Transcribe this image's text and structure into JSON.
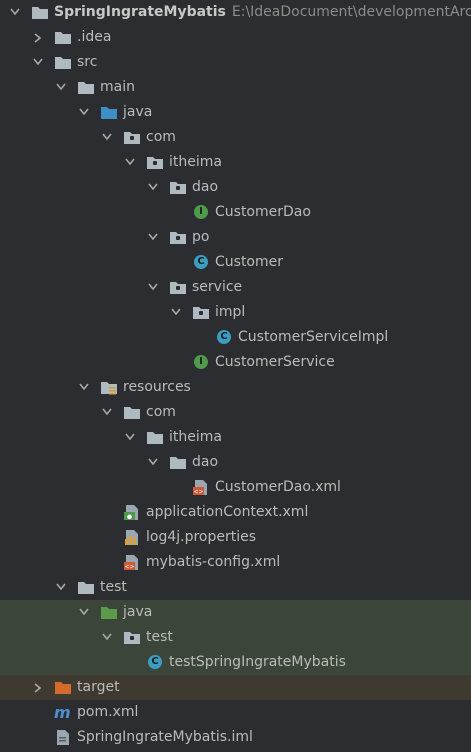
{
  "project": {
    "name": "SpringIngrateMybatis",
    "path": "E:\\IdeaDocument\\developmentArc"
  },
  "tree": [
    {
      "label": "SpringIngrateMybatis",
      "depth": 0,
      "arrow": "down",
      "icon": "module-folder-icon",
      "bold": true,
      "path": "E:\\IdeaDocument\\developmentArc",
      "bg": "top"
    },
    {
      "label": ".idea",
      "depth": 1,
      "arrow": "right",
      "icon": "folder-icon"
    },
    {
      "label": "src",
      "depth": 1,
      "arrow": "down",
      "icon": "folder-icon"
    },
    {
      "label": "main",
      "depth": 2,
      "arrow": "down",
      "icon": "folder-icon"
    },
    {
      "label": "java",
      "depth": 3,
      "arrow": "down",
      "icon": "source-folder-icon"
    },
    {
      "label": "com",
      "depth": 4,
      "arrow": "down",
      "icon": "package-icon"
    },
    {
      "label": "itheima",
      "depth": 5,
      "arrow": "down",
      "icon": "package-icon"
    },
    {
      "label": "dao",
      "depth": 6,
      "arrow": "down",
      "icon": "package-icon"
    },
    {
      "label": "CustomerDao",
      "depth": 7,
      "arrow": "none",
      "icon": "interface-icon"
    },
    {
      "label": "po",
      "depth": 6,
      "arrow": "down",
      "icon": "package-icon"
    },
    {
      "label": "Customer",
      "depth": 7,
      "arrow": "none",
      "icon": "class-icon"
    },
    {
      "label": "service",
      "depth": 6,
      "arrow": "down",
      "icon": "package-icon"
    },
    {
      "label": "impl",
      "depth": 7,
      "arrow": "down",
      "icon": "package-icon"
    },
    {
      "label": "CustomerServiceImpl",
      "depth": 8,
      "arrow": "none",
      "icon": "class-icon"
    },
    {
      "label": "CustomerService",
      "depth": 7,
      "arrow": "none",
      "icon": "interface-icon"
    },
    {
      "label": "resources",
      "depth": 3,
      "arrow": "down",
      "icon": "resources-folder-icon"
    },
    {
      "label": "com",
      "depth": 4,
      "arrow": "down",
      "icon": "folder-icon"
    },
    {
      "label": "itheima",
      "depth": 5,
      "arrow": "down",
      "icon": "folder-icon"
    },
    {
      "label": "dao",
      "depth": 6,
      "arrow": "down",
      "icon": "folder-icon"
    },
    {
      "label": "CustomerDao.xml",
      "depth": 7,
      "arrow": "none",
      "icon": "xml-file-icon"
    },
    {
      "label": "applicationContext.xml",
      "depth": 4,
      "arrow": "none",
      "icon": "spring-xml-icon"
    },
    {
      "label": "log4j.properties",
      "depth": 4,
      "arrow": "none",
      "icon": "properties-file-icon"
    },
    {
      "label": "mybatis-config.xml",
      "depth": 4,
      "arrow": "none",
      "icon": "xml-file-icon"
    },
    {
      "label": "test",
      "depth": 2,
      "arrow": "down",
      "icon": "folder-icon"
    },
    {
      "label": "java",
      "depth": 3,
      "arrow": "down",
      "icon": "test-source-folder-icon",
      "bg": "green"
    },
    {
      "label": "test",
      "depth": 4,
      "arrow": "down",
      "icon": "package-icon",
      "bg": "green"
    },
    {
      "label": "testSpringIngrateMybatis",
      "depth": 5,
      "arrow": "none",
      "icon": "test-class-icon",
      "bg": "green"
    },
    {
      "label": "target",
      "depth": 1,
      "arrow": "right",
      "icon": "excluded-folder-icon",
      "bg": "brown"
    },
    {
      "label": "pom.xml",
      "depth": 1,
      "arrow": "none",
      "icon": "maven-icon"
    },
    {
      "label": "SpringIngrateMybatis.iml",
      "depth": 1,
      "arrow": "none",
      "icon": "iml-file-icon"
    }
  ],
  "colors": {
    "background": "#2b2d30",
    "text": "#bbbbbb",
    "folder": "#aeb9c0",
    "source_folder": "#3d8fc6",
    "test_source_folder": "#5b9b4a",
    "excluded_folder": "#d46a2b",
    "interface": "#4f9a4b",
    "class": "#3a9ec2",
    "xml": "#cf5a3a",
    "test_row_bg": "#3b4539",
    "excluded_row_bg": "#3e3a30"
  }
}
